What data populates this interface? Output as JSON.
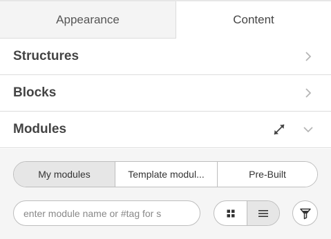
{
  "tabs": [
    {
      "label": "Appearance",
      "active": false
    },
    {
      "label": "Content",
      "active": true
    }
  ],
  "sections": [
    {
      "title": "Structures",
      "state": "collapsed",
      "icon": "chevron-right-icon"
    },
    {
      "title": "Blocks",
      "state": "collapsed",
      "icon": "chevron-right-icon"
    },
    {
      "title": "Modules",
      "state": "expanded",
      "icon": "chevron-down-icon",
      "extra_icon": "expand-arrows-icon"
    }
  ],
  "modules": {
    "segments": [
      {
        "label": "My modules",
        "active": true
      },
      {
        "label": "Template modul...",
        "active": false
      },
      {
        "label": "Pre-Built",
        "active": false
      }
    ],
    "search": {
      "placeholder": "enter module name or #tag for s",
      "value": ""
    },
    "view_toggle": {
      "options": [
        "grid-view-icon",
        "list-view-icon"
      ],
      "active": "list-view-icon"
    },
    "filter_icon": "filter-funnel-icon"
  },
  "colors": {
    "border": "#dcdcdc",
    "active_segment": "#e6e6e6",
    "panel_bg": "#f5f5f5",
    "inactive_tab_bg": "#f4f4f4",
    "title_text": "#444444"
  }
}
